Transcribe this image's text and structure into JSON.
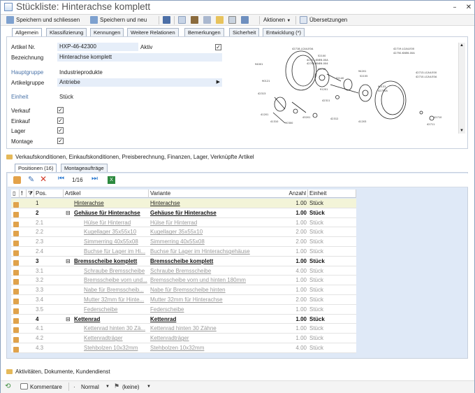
{
  "window": {
    "title": "Stückliste: Hinterachse komplett",
    "close": "✕"
  },
  "toolbar": {
    "save_close": "Speichern und schliessen",
    "save_new": "Speichern und neu",
    "actions": "Aktionen",
    "translations": "Übersetzungen"
  },
  "tabs": [
    "Allgemein",
    "Klassifizierung",
    "Kennungen",
    "Weitere Relationen",
    "Bemerkungen",
    "Sicherheit",
    "Entwicklung (*)"
  ],
  "general": {
    "article_no_label": "Artikel Nr.",
    "article_no": "HXP-46-42300",
    "active_label": "Aktiv",
    "active": true,
    "name_label": "Bezeichnung",
    "name": "Hinterachse komplett",
    "main_group_label": "Hauptgruppe",
    "main_group": "Industrieprodukte",
    "article_group_label": "Artikelgruppe",
    "article_group": "Antriebe",
    "unit_label": "Einheit",
    "unit": "Stück",
    "flags": [
      {
        "label": "Verkauf",
        "checked": true
      },
      {
        "label": "Einkauf",
        "checked": true
      },
      {
        "label": "Lager",
        "checked": true
      },
      {
        "label": "Montage",
        "checked": true
      }
    ]
  },
  "sections": {
    "sales": "Verkaufskonditionen, Einkaufskonditionen, Preisberechnung, Finanzen, Lager, Verknüpfte Artikel",
    "activities": "Aktivitäten, Dokumente, Kundendienst"
  },
  "subtabs": [
    "Positionen (16)",
    "Montageaufträge"
  ],
  "grid": {
    "pager": "1/16",
    "headers": {
      "pos": "Pos.",
      "article": "Artikel",
      "variant": "Variante",
      "qty": "Anzahl",
      "unit": "Einheit"
    },
    "rows": [
      {
        "pos": "1",
        "article": "Hinterachse",
        "variant": "Hinterachse",
        "qty": "1.00",
        "unit": "Stück",
        "level": 0,
        "style": "sel"
      },
      {
        "pos": "2",
        "article": "Gehäuse für Hinterachse",
        "variant": "Gehäuse für Hinterachse",
        "qty": "1.00",
        "unit": "Stück",
        "level": 0,
        "style": "group"
      },
      {
        "pos": "2.1",
        "article": "Hülse für Hinterrad",
        "variant": "Hülse für Hinterrad",
        "qty": "1.00",
        "unit": "Stück",
        "level": 1,
        "style": "child"
      },
      {
        "pos": "2.2",
        "article": "Kugellager 35x55x10",
        "variant": "Kugellager 35x55x10",
        "qty": "2.00",
        "unit": "Stück",
        "level": 1,
        "style": "child"
      },
      {
        "pos": "2.3",
        "article": "Simmerring 40x55x08",
        "variant": "Simmerring 40x55x08",
        "qty": "2.00",
        "unit": "Stück",
        "level": 1,
        "style": "child"
      },
      {
        "pos": "2.4",
        "article": "Buchse für Lager im Hi...",
        "variant": "Buchse für Lager im Hinterachsgehäuse",
        "qty": "1.00",
        "unit": "Stück",
        "level": 1,
        "style": "child"
      },
      {
        "pos": "3",
        "article": "Bremsscheibe komplett",
        "variant": "Bremsscheibe komplett",
        "qty": "1.00",
        "unit": "Stück",
        "level": 0,
        "style": "group"
      },
      {
        "pos": "3.1",
        "article": "Schraube Bremsscheibe",
        "variant": "Schraube Bremsscheibe",
        "qty": "4.00",
        "unit": "Stück",
        "level": 1,
        "style": "child"
      },
      {
        "pos": "3.2",
        "article": "Bremsscheibe vorn und...",
        "variant": "Bremsscheibe vorn und hinten 180mm",
        "qty": "1.00",
        "unit": "Stück",
        "level": 1,
        "style": "child"
      },
      {
        "pos": "3.3",
        "article": "Nabe für Bremsscheib...",
        "variant": "Nabe für Bremsscheibe hinten",
        "qty": "1.00",
        "unit": "Stück",
        "level": 1,
        "style": "child"
      },
      {
        "pos": "3.4",
        "article": "Mutter 32mm für Hinte...",
        "variant": "Mutter 32mm für Hinterachse",
        "qty": "2.00",
        "unit": "Stück",
        "level": 1,
        "style": "child"
      },
      {
        "pos": "3.5",
        "article": "Federscheibe",
        "variant": "Federscheibe",
        "qty": "1.00",
        "unit": "Stück",
        "level": 1,
        "style": "child"
      },
      {
        "pos": "4",
        "article": "Kettenrad",
        "variant": "Kettenrad",
        "qty": "1.00",
        "unit": "Stück",
        "level": 0,
        "style": "group"
      },
      {
        "pos": "4.1",
        "article": "Kettenrad hinten 30 Zä...",
        "variant": "Kettenrad hinten 30 Zähne",
        "qty": "1.00",
        "unit": "Stück",
        "level": 1,
        "style": "child"
      },
      {
        "pos": "4.2",
        "article": "Kettenradträger",
        "variant": "Kettenradträger",
        "qty": "1.00",
        "unit": "Stück",
        "level": 1,
        "style": "child"
      },
      {
        "pos": "4.3",
        "article": "Stehbolzen 10x32mm",
        "variant": "Stehbolzen 10x32mm",
        "qty": "4.00",
        "unit": "Stück",
        "level": 1,
        "style": "child"
      }
    ]
  },
  "statusbar": {
    "comments": "Kommentare",
    "priority": "Normal",
    "flag": "(keine)"
  },
  "drawing_labels": [
    "42718-LCA4-E0A",
    "42719-LCA4-E00",
    "42750-KNE6-00A",
    "42751-KNE6-00A",
    "42705-KNE6-004",
    "94001",
    "52100",
    "42755",
    "90121",
    "91201",
    "52140",
    "94201",
    "52155",
    "90131",
    "42750A",
    "42311",
    "42313",
    "42713-LCA4-E00",
    "42710-LCA4-E0A",
    "41201",
    "41310",
    "90300",
    "43201",
    "42312",
    "41203",
    "42710",
    "42711"
  ]
}
